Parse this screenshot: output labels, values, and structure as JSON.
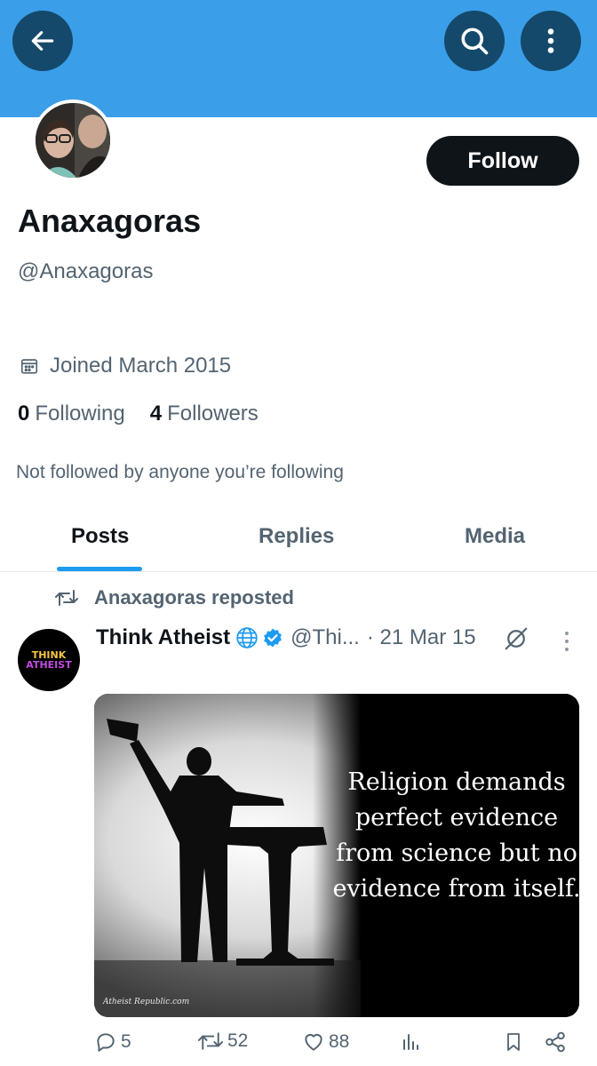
{
  "header": {
    "back_icon": "arrow-left-icon",
    "search_icon": "search-icon",
    "more_icon": "more-vertical-icon",
    "banner_color": "#3b9ee8"
  },
  "profile": {
    "display_name": "Anaxagoras",
    "handle": "@Anaxagoras",
    "follow_label": "Follow",
    "joined": "Joined March 2015",
    "following_count": "0",
    "following_label": "Following",
    "followers_count": "4",
    "followers_label": "Followers",
    "not_followed": "Not followed by anyone you’re following"
  },
  "tabs": [
    {
      "label": "Posts",
      "active": true
    },
    {
      "label": "Replies",
      "active": false
    },
    {
      "label": "Media",
      "active": false
    }
  ],
  "post": {
    "repost_label": "Anaxagoras reposted",
    "author": "Think Atheist",
    "handle": "@Thi...",
    "date": "· 21 Mar 15",
    "avatar_text": [
      "THINK",
      "ATHEIST"
    ],
    "image_text": "Religion demands perfect evidence from science but no evidence from itself.",
    "image_watermark": "Atheist Republic.com",
    "replies": "5",
    "reposts": "52",
    "likes": "88"
  },
  "colors": {
    "accent": "#1d9bf0",
    "text": "#0f1419",
    "secondary": "#536471"
  }
}
